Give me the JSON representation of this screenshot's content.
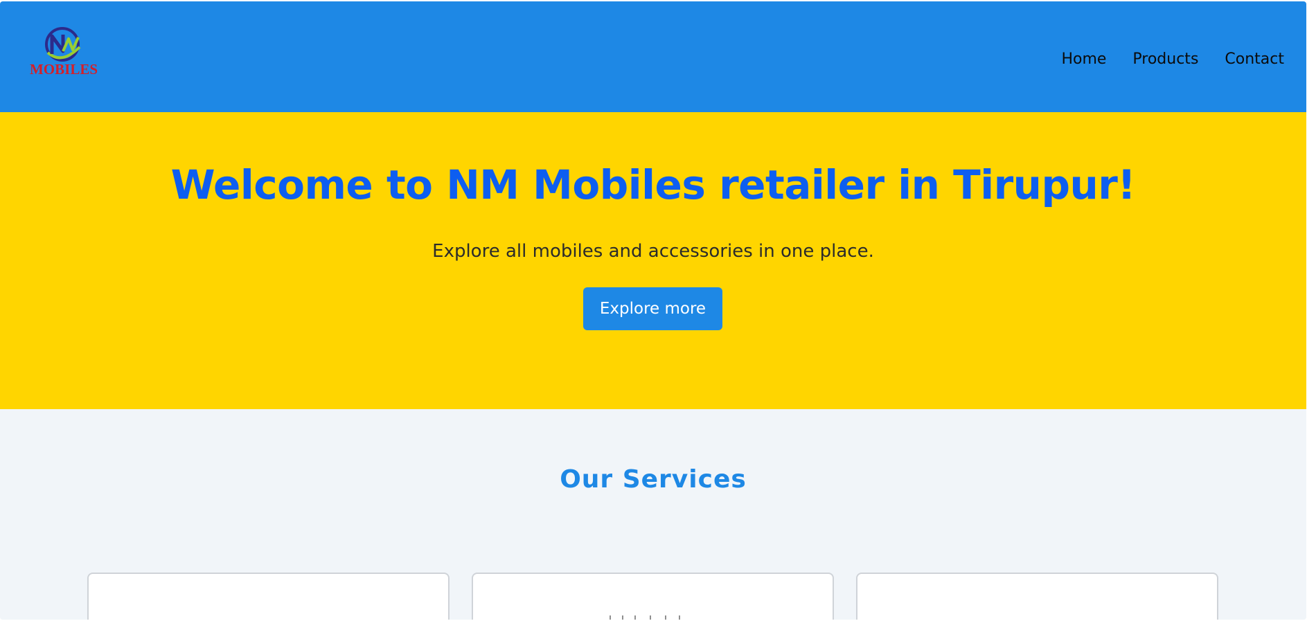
{
  "header": {
    "logo": {
      "monogram": "NM",
      "wordmark": "MOBILES"
    },
    "nav": [
      {
        "label": "Home"
      },
      {
        "label": "Products"
      },
      {
        "label": "Contact"
      }
    ]
  },
  "hero": {
    "title": "Welcome to NM Mobiles retailer in Tirupur!",
    "subtitle": "Explore all mobiles and accessories in one place.",
    "cta_label": "Explore more"
  },
  "services": {
    "heading": "Our Services",
    "cards": [
      {
        "id": "service-card-1"
      },
      {
        "id": "service-card-2"
      },
      {
        "id": "service-card-3"
      }
    ]
  },
  "colors": {
    "header_bg": "#1e88e5",
    "hero_bg": "#ffd500",
    "title_color": "#0d5ef0",
    "accent": "#1e88e5",
    "section_bg": "#f1f5f9",
    "logo_red": "#d3202a",
    "logo_navy": "#2c2a8a",
    "logo_green": "#9acd32"
  }
}
